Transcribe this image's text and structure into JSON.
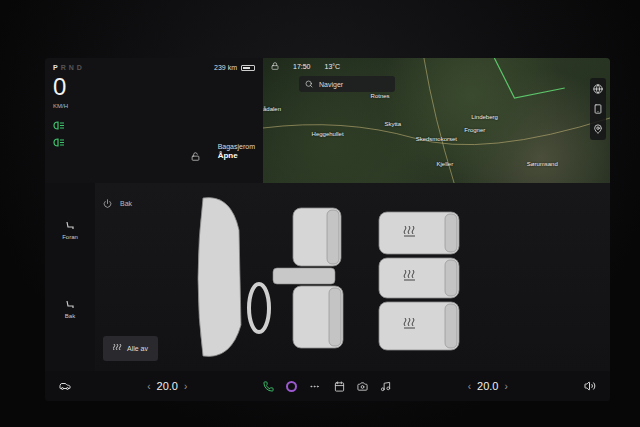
{
  "status": {
    "gears": [
      {
        "label": "P",
        "selected": true
      },
      {
        "label": "R",
        "selected": false
      },
      {
        "label": "N",
        "selected": false
      },
      {
        "label": "D",
        "selected": false
      }
    ],
    "range": "239 km",
    "speed": "0",
    "speed_unit": "KM/H"
  },
  "trunk": {
    "title": "Bagasjerom",
    "action": "Åpne"
  },
  "map": {
    "time": "17:50",
    "temperature": "13°C",
    "search_placeholder": "Naviger",
    "places": [
      {
        "name": "ådalen"
      },
      {
        "name": "Rotnes"
      },
      {
        "name": "Heggehullet"
      },
      {
        "name": "Skytta"
      },
      {
        "name": "Skedsmokorset"
      },
      {
        "name": "Lindeberg"
      },
      {
        "name": "Frogner"
      },
      {
        "name": "Kjeller"
      },
      {
        "name": "Sørumsand"
      }
    ]
  },
  "climate": {
    "power_label": "Bak",
    "zones": [
      {
        "label": "Foran"
      },
      {
        "label": "Bak"
      }
    ],
    "all_off": "Alle av",
    "seats": [
      {
        "name": "front-left",
        "heated": false
      },
      {
        "name": "front-right",
        "heated": false
      },
      {
        "name": "rear-left",
        "heated": true
      },
      {
        "name": "rear-center",
        "heated": true
      },
      {
        "name": "rear-right",
        "heated": true
      }
    ]
  },
  "bottom_bar": {
    "left_temp": "20.0",
    "right_temp": "20.0",
    "decrease": "‹",
    "increase": "›"
  }
}
